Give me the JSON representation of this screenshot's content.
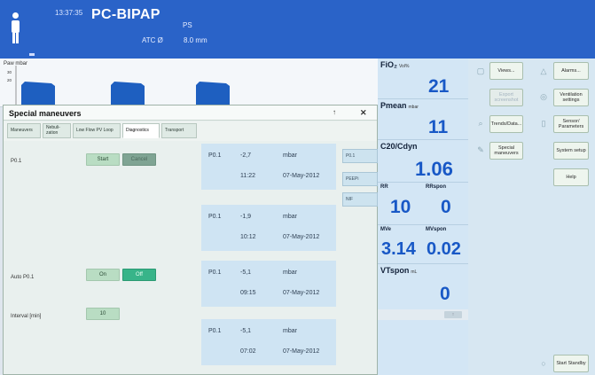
{
  "header": {
    "time": "13:37:35",
    "mode": "PC-BIPAP",
    "sub_mode": "PS",
    "atc_label": "ATC Ø",
    "tube_size": "8.0 mm"
  },
  "waveform": {
    "label": "Paw mbar",
    "y_ticks": [
      "30",
      "20"
    ],
    "color": "#1e5fc0"
  },
  "parameters": {
    "fio2": {
      "label": "FiO₂",
      "unit": "Vol%",
      "value": "21"
    },
    "pmean": {
      "label": "Pmean",
      "unit": "mbar",
      "value": "11"
    },
    "c20": {
      "label": "C20/Cdyn",
      "value": "1.06"
    },
    "rr": {
      "label": "RR",
      "value": "10"
    },
    "rrspon": {
      "label": "RRspon",
      "value": "0"
    },
    "mve": {
      "label": "MVe",
      "value": "3.14"
    },
    "mvspon": {
      "label": "MVspon",
      "value": "0.02"
    },
    "vtspon": {
      "label": "VTspon",
      "unit": "mL",
      "value": "0"
    },
    "value_color": "#1858c6"
  },
  "right_menu": {
    "views": "Views...",
    "alarms": "Alarms...",
    "export": "Export screenshot",
    "vent_settings": "Ventilation settings",
    "trends": "Trends/Data...",
    "sensor": "Sensor/ Parameters",
    "special": "Special maneuvers",
    "system_setup": "System setup",
    "help": "Help",
    "start_standby": "Start Standby"
  },
  "dialog": {
    "title": "Special maneuvers",
    "tabs": [
      "Maneuvers",
      "Nebuli-zation",
      "Low Flow PV Loop",
      "Diagnostics",
      "Transport"
    ],
    "active_tab": "Diagnostics",
    "p01_label": "P0.1",
    "start_label": "Start",
    "cancel_label": "Cancel",
    "auto_p01_label": "Auto P0.1",
    "on_label": "On",
    "off_label": "Off",
    "interval_label": "Interval [min]",
    "interval_value": "10",
    "side_buttons": [
      "P0.1",
      "PEEPi",
      "NIF"
    ]
  },
  "results": [
    {
      "name": "P0.1",
      "value": "-2,7",
      "unit": "mbar",
      "time": "11:22",
      "date": "07-May-2012"
    },
    {
      "name": "P0.1",
      "value": "-1,9",
      "unit": "mbar",
      "time": "10:12",
      "date": "07-May-2012"
    },
    {
      "name": "P0.1",
      "value": "-5,1",
      "unit": "mbar",
      "time": "09:15",
      "date": "07-May-2012"
    },
    {
      "name": "P0.1",
      "value": "-5,1",
      "unit": "mbar",
      "time": "07:02",
      "date": "07-May-2012"
    }
  ]
}
